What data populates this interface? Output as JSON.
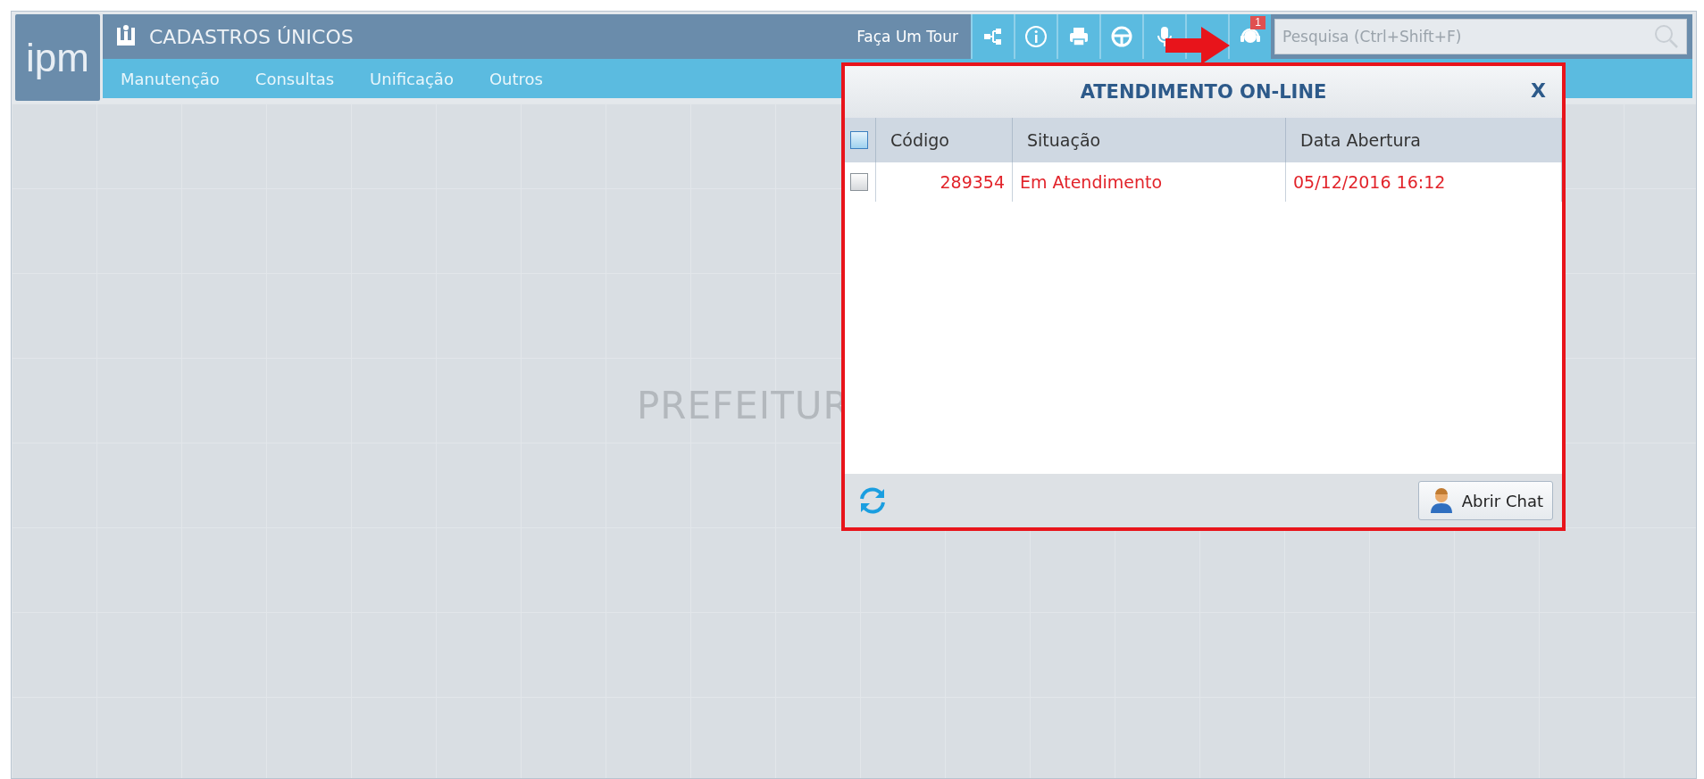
{
  "app": {
    "logo": "ipm",
    "title": "CADASTROS ÚNICOS",
    "tour_link": "Faça Um Tour",
    "notification_count": "1",
    "search": {
      "placeholder": "Pesquisa (Ctrl+Shift+F)"
    },
    "menu": [
      "Manutenção",
      "Consultas",
      "Unificação",
      "Outros"
    ]
  },
  "workspace": {
    "background_text": "PREFEITUR"
  },
  "popup": {
    "title": "ATENDIMENTO ON-LINE",
    "close": "X",
    "table": {
      "select_all_checked": false,
      "columns": [
        "Código",
        "Situação",
        "Data Abertura"
      ],
      "rows": [
        {
          "checked": false,
          "cells": [
            "289354",
            "Em Atendimento",
            "05/12/2016 16:12"
          ]
        }
      ]
    },
    "button": "Abrir Chat"
  }
}
